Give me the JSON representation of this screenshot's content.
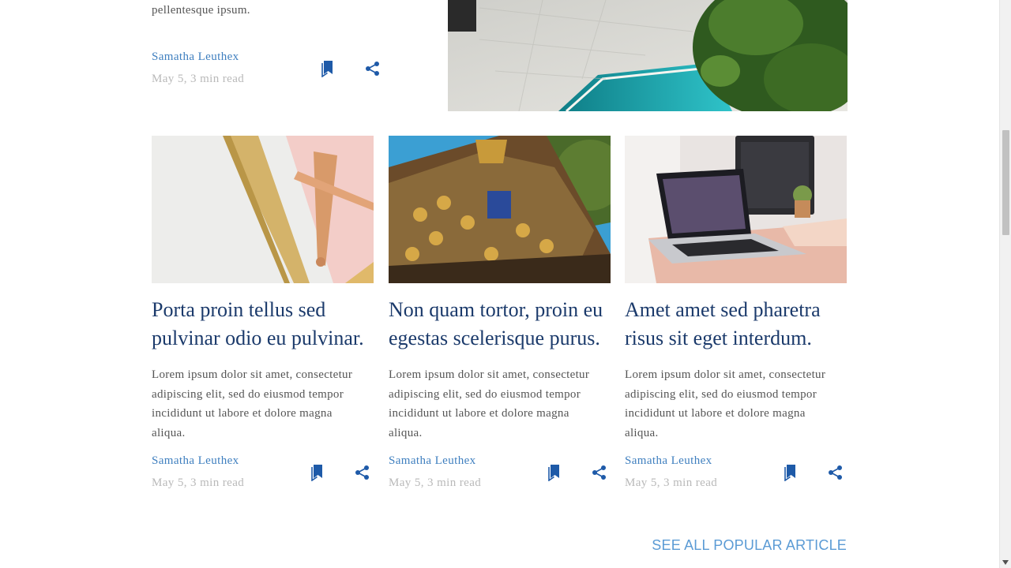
{
  "top_article": {
    "excerpt_tail": "pellentesque ipsum.",
    "author": "Samatha Leuthex",
    "meta": "May 5, 3 min read",
    "bookmark_icon": "bookmark-icon",
    "share_icon": "share-icon"
  },
  "cards": [
    {
      "title": "Porta proin tellus sed pulvinar odio eu pulvinar.",
      "excerpt": "Lorem ipsum dolor sit amet, consectetur adipiscing elit, sed do eiusmod tempor incididunt ut labore et dolore magna aliqua.",
      "author": "Samatha Leuthex",
      "meta": "May 5, 3 min read"
    },
    {
      "title": "Non quam tortor, proin eu egestas scelerisque purus.",
      "excerpt": "Lorem ipsum dolor sit amet, consectetur adipiscing elit, sed do eiusmod tempor incididunt ut labore et dolore magna aliqua.",
      "author": "Samatha Leuthex",
      "meta": "May 5, 3 min read"
    },
    {
      "title": "Amet amet sed pharetra risus sit eget interdum.",
      "excerpt": "Lorem ipsum dolor sit amet, consectetur adipiscing elit, sed do eiusmod tempor incididunt ut labore et dolore magna aliqua.",
      "author": "Samatha Leuthex",
      "meta": "May 5, 3 min read"
    }
  ],
  "see_all_label": "SEE ALL POPULAR ARTICLE",
  "colors": {
    "title": "#1b3a6b",
    "author": "#3f7fbf",
    "icon": "#1e5aa8",
    "link": "#5b9bd5"
  }
}
